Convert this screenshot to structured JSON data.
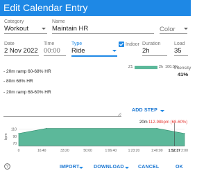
{
  "dialog": {
    "title": "Edit Calendar Entry"
  },
  "row1": {
    "category_label": "Category",
    "category_value": "Workout",
    "name_label": "Name",
    "name_value": "Maintain HR",
    "color_placeholder": "Color"
  },
  "row2": {
    "date_label": "Date",
    "date_value": "2 Nov 2022",
    "time_label": "Time",
    "time_value": "00:00",
    "type_label": "Type",
    "type_value": "Ride",
    "indoor_label": "Indoor",
    "indoor_checked": true,
    "duration_label": "Duration",
    "duration_value": "2h",
    "load_label": "Load",
    "load_value": "35"
  },
  "description": {
    "lines": [
      "- 20m ramp 60-68% HR",
      "- 80m 68% HR",
      "- 20m ramp 68-60% HR"
    ]
  },
  "zone_bar": {
    "left_label": "Z1",
    "time_text": "2h",
    "percent_text": "100.0%",
    "fill_fraction": 1.0
  },
  "intensity": {
    "label": "Intensity",
    "value": "41%"
  },
  "add_step": "ADD STEP",
  "chart_data": {
    "type": "area",
    "title": "",
    "annotation": {
      "duration": "20m",
      "text": "112-98bpm (68-60%)"
    },
    "ylabel": "bpm",
    "yticks": [
      70,
      90,
      110
    ],
    "ylim": [
      63,
      115
    ],
    "xlim": [
      0,
      120
    ],
    "xticks": [
      "0",
      "16:40",
      "33:20",
      "50:00",
      "1:06:40",
      "1:23:20",
      "1:40:00",
      "1:52:37",
      "2:00"
    ],
    "xtick_minutes": [
      0,
      16.67,
      33.33,
      50,
      66.67,
      83.33,
      100,
      112.62,
      120
    ],
    "series": [
      {
        "x": [
          0,
          20,
          100,
          120
        ],
        "y": [
          98,
          112,
          112,
          98
        ]
      }
    ],
    "cursor_minutes": 112.62,
    "colors": {
      "fill": "#5cb89a",
      "stroke": "#2f8a6b"
    }
  },
  "footer": {
    "help_icon": "help-circle-icon",
    "import_label": "IMPORT",
    "download_label": "DOWNLOAD",
    "cancel_label": "CANCEL",
    "ok_label": "OK"
  }
}
